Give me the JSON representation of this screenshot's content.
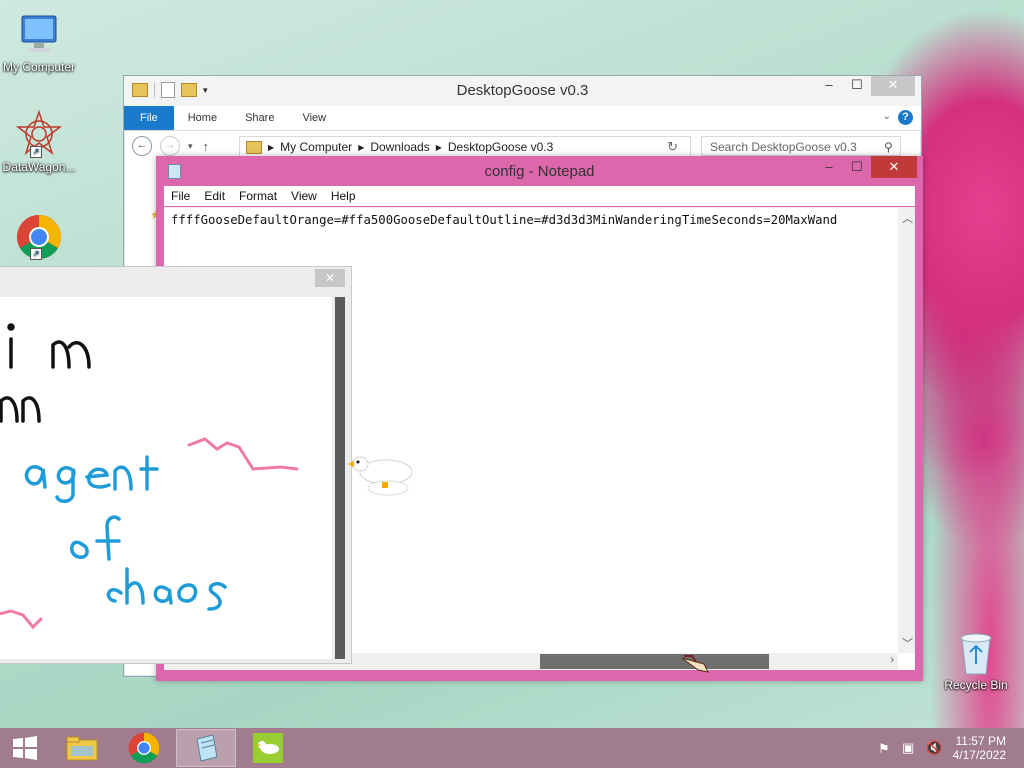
{
  "desktop": {
    "icons": [
      {
        "label": "My Computer"
      },
      {
        "label": "DataWagon..."
      },
      {
        "label": ""
      },
      {
        "label": "Recycle Bin"
      }
    ]
  },
  "explorer": {
    "title": "DesktopGoose v0.3",
    "ribbon_tabs": [
      "File",
      "Home",
      "Share",
      "View"
    ],
    "address": [
      "My Computer",
      "Downloads",
      "DesktopGoose v0.3"
    ],
    "search_placeholder": "Search DesktopGoose v0.3"
  },
  "notepad": {
    "title": "config - Notepad",
    "menu": [
      "File",
      "Edit",
      "Format",
      "View",
      "Help"
    ],
    "content": "ffffGooseDefaultOrange=#ffa500GooseDefaultOutline=#d3d3d3MinWanderingTimeSeconds=20MaxWand"
  },
  "drawing": {
    "lines": [
      "i m",
      "nn",
      "agent",
      "of",
      "chaos"
    ],
    "colors": {
      "black": "#111111",
      "blue": "#1f9bd8",
      "pink": "#f07aa2"
    }
  },
  "taskbar": {
    "time": "11:57 PM",
    "date": "4/17/2022"
  },
  "colors": {
    "notepad_frame": "#dd67ac",
    "close_red": "#c13a3a",
    "file_tab": "#1979ca",
    "taskbar": "#a07c8e"
  }
}
